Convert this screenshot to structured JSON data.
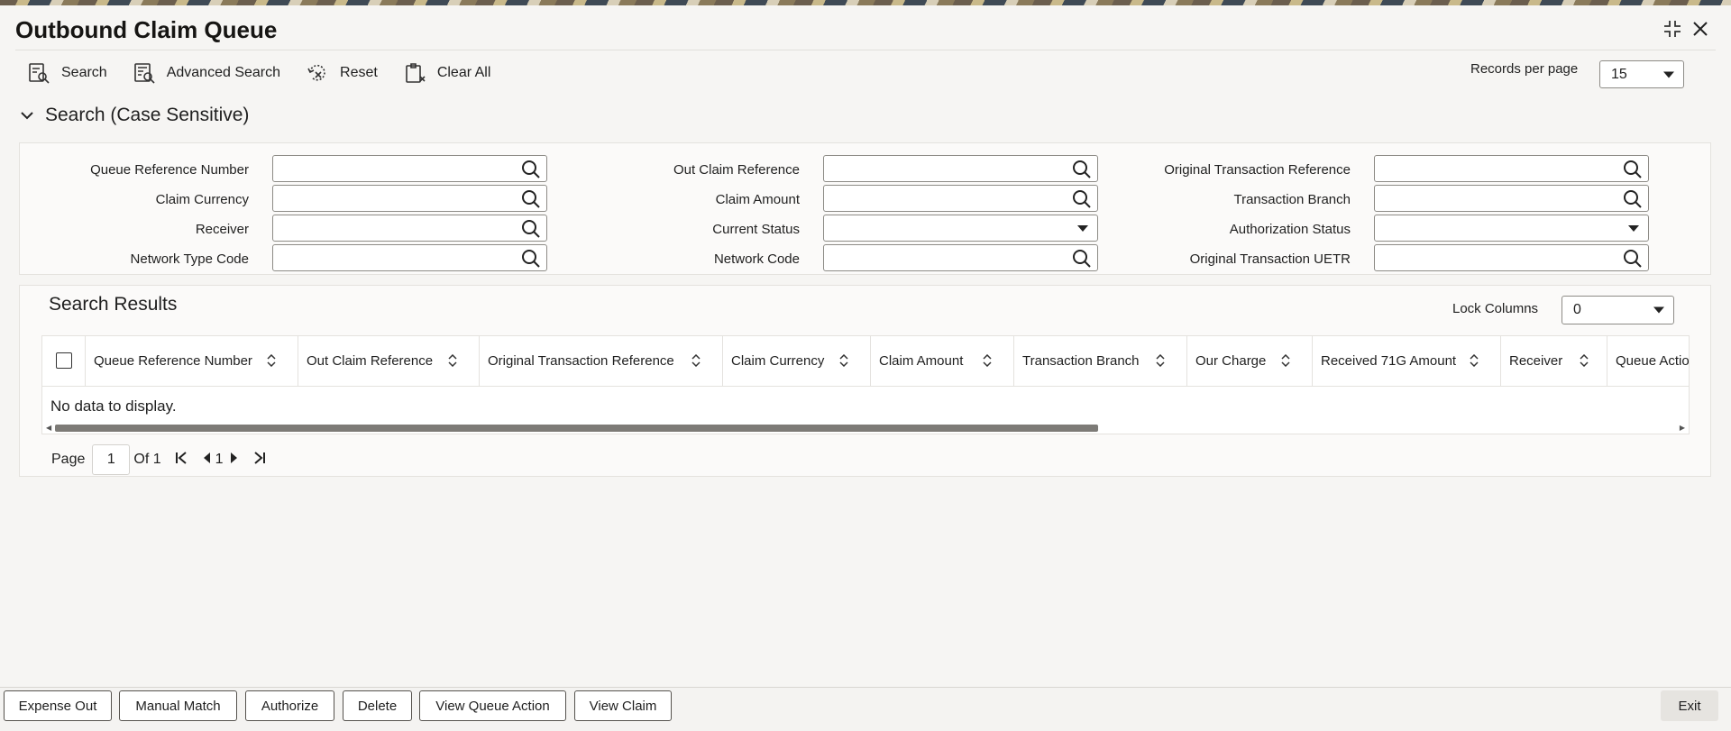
{
  "window": {
    "title": "Outbound Claim Queue"
  },
  "toolbar": {
    "search": "Search",
    "advanced_search": "Advanced Search",
    "reset": "Reset",
    "clear_all": "Clear All",
    "records_per_page_label": "Records per page",
    "records_per_page_value": "15"
  },
  "search_section": {
    "title": "Search (Case Sensitive)",
    "fields": {
      "queue_reference_number": "Queue Reference Number",
      "out_claim_reference": "Out Claim Reference",
      "original_transaction_reference": "Original Transaction Reference",
      "claim_currency": "Claim Currency",
      "claim_amount": "Claim Amount",
      "transaction_branch": "Transaction Branch",
      "receiver": "Receiver",
      "current_status": "Current Status",
      "authorization_status": "Authorization Status",
      "network_type_code": "Network Type Code",
      "network_code": "Network Code",
      "original_transaction_uetr": "Original Transaction UETR"
    }
  },
  "results": {
    "title": "Search Results",
    "lock_columns_label": "Lock Columns",
    "lock_columns_value": "0",
    "columns": [
      "Queue Reference Number",
      "Out Claim Reference",
      "Original Transaction Reference",
      "Claim Currency",
      "Claim Amount",
      "Transaction Branch",
      "Our Charge",
      "Received 71G Amount",
      "Receiver",
      "Queue Actio"
    ],
    "empty_message": "No data to display."
  },
  "pager": {
    "page_label": "Page",
    "page_value": "1",
    "of_label": "Of 1",
    "current_page": "1"
  },
  "footer": {
    "expense_out": "Expense Out",
    "manual_match": "Manual Match",
    "authorize": "Authorize",
    "delete": "Delete",
    "view_queue_action": "View Queue Action",
    "view_claim": "View Claim",
    "exit": "Exit"
  }
}
